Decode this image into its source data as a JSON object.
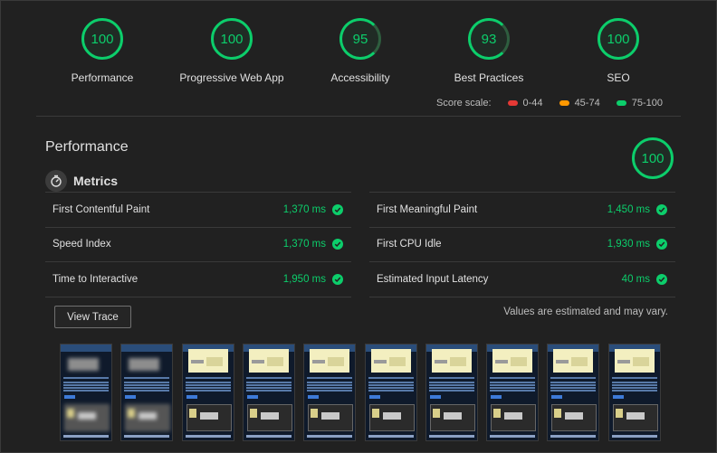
{
  "categories": [
    {
      "score": "100",
      "label": "Performance"
    },
    {
      "score": "100",
      "label": "Progressive Web App"
    },
    {
      "score": "95",
      "label": "Accessibility"
    },
    {
      "score": "93",
      "label": "Best Practices"
    },
    {
      "score": "100",
      "label": "SEO"
    }
  ],
  "score_scale": {
    "label": "Score scale:",
    "ranges": [
      {
        "label": "0-44",
        "color": "#e53935"
      },
      {
        "label": "45-74",
        "color": "#ff9800"
      },
      {
        "label": "75-100",
        "color": "#0cce6b"
      }
    ]
  },
  "performance": {
    "title": "Performance",
    "score": "100",
    "metrics_title": "Metrics",
    "metrics": [
      {
        "name": "First Contentful Paint",
        "value": "1,370 ms"
      },
      {
        "name": "First Meaningful Paint",
        "value": "1,450 ms"
      },
      {
        "name": "Speed Index",
        "value": "1,370 ms"
      },
      {
        "name": "First CPU Idle",
        "value": "1,930 ms"
      },
      {
        "name": "Time to Interactive",
        "value": "1,950 ms"
      },
      {
        "name": "Estimated Input Latency",
        "value": "40 ms"
      }
    ],
    "view_trace_label": "View Trace",
    "note": "Values are estimated and may vary."
  },
  "colors": {
    "pass": "#0cce6b",
    "background": "#212121"
  },
  "filmstrip_frames": 10
}
